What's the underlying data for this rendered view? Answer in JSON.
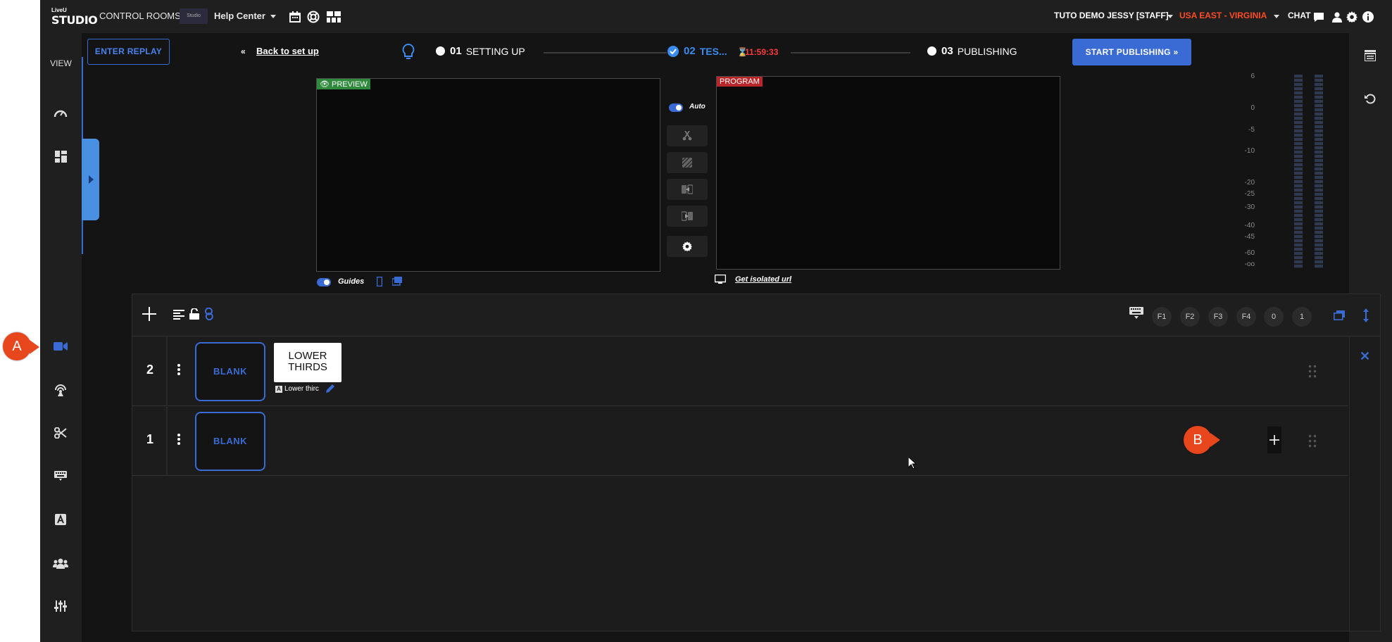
{
  "topbar": {
    "logo_small": "LiveU",
    "logo_big": "STUDIO",
    "control_rooms": "CONTROL ROOMS",
    "studio_thumb_label": "Studio",
    "help_center": "Help Center",
    "user": "TUTO DEMO JESSY [STAFF]",
    "region": "USA EAST - VIRGINIA",
    "chat": "CHAT"
  },
  "nav": {
    "view_label": "VIEW"
  },
  "header": {
    "enter_replay": "ENTER REPLAY",
    "back_to_setup": "Back to set up",
    "steps": [
      {
        "num": "01",
        "label": "SETTING UP"
      },
      {
        "num": "02",
        "label": "TES..."
      },
      {
        "num": "03",
        "label": "PUBLISHING"
      }
    ],
    "timer": "11:59:33",
    "start_publishing": "START PUBLISHING"
  },
  "preview": {
    "tag": "PREVIEW",
    "guides": "Guides"
  },
  "program": {
    "tag": "PROGRAM",
    "isolated_url": "Get isolated url"
  },
  "switcher": {
    "auto": "Auto"
  },
  "meter_labels": [
    "6",
    "0",
    "-5",
    "-10",
    "-20",
    "-25",
    "-30",
    "-40",
    "-45",
    "-60",
    "-oo"
  ],
  "layers": {
    "fkeys": [
      "F1",
      "F2",
      "F3",
      "F4",
      "0",
      "1"
    ],
    "rows": [
      {
        "num": "2",
        "blank": "BLANK",
        "lower_title": "LOWER THIRDS",
        "lower_caption": "Lower thirc"
      },
      {
        "num": "1",
        "blank": "BLANK"
      }
    ]
  },
  "callouts": {
    "a": "A",
    "b": "B"
  },
  "colors": {
    "accent": "#3a6bd4",
    "preview": "#2f8a3c",
    "program": "#b8262a",
    "callout": "#e8461d",
    "region": "#ff4b26"
  }
}
